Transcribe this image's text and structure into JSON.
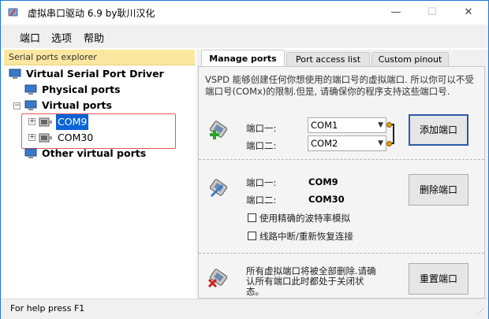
{
  "window": {
    "title": "虚拟串口驱动 6.9 by耿川汉化",
    "minimize": "—",
    "maximize": "☐",
    "close": "✕"
  },
  "menu": [
    "端口",
    "选项",
    "帮助"
  ],
  "explorer": {
    "header": "Serial ports explorer",
    "root": "Virtual Serial Port Driver",
    "physical": "Physical ports",
    "virtual": "Virtual ports",
    "ports": [
      "COM9",
      "COM30"
    ],
    "other": "Other virtual ports"
  },
  "tabs": [
    "Manage ports",
    "Port access list",
    "Custom pinout"
  ],
  "manage": {
    "description": "VSPD 能够创建任何你想使用的端口号的虚拟端口. 所以你可以不受端口号(COMx)的限制.但是, 请确保你的程序支持这些端口号.",
    "add": {
      "port1_label": "端口一:",
      "port2_label": "端口二:",
      "port1_value": "COM1",
      "port2_value": "COM2",
      "button": "添加端口"
    },
    "delete": {
      "port1_label": "端口一:",
      "port2_label": "端口二:",
      "port1_value": "COM9",
      "port2_value": "COM30",
      "button": "删除端口",
      "check1": "使用精确的波特率模拟",
      "check2": "线路中断/重新恢复连接"
    },
    "reset": {
      "text": "所有虚拟端口将被全部删除.请确认所有端口此时都处于关闭状态。",
      "button": "重置端口"
    }
  },
  "status": "For help press F1",
  "colors": {
    "accent": "#0a64d6",
    "header": "#fce7a1",
    "highlight": "#e05a5a"
  }
}
